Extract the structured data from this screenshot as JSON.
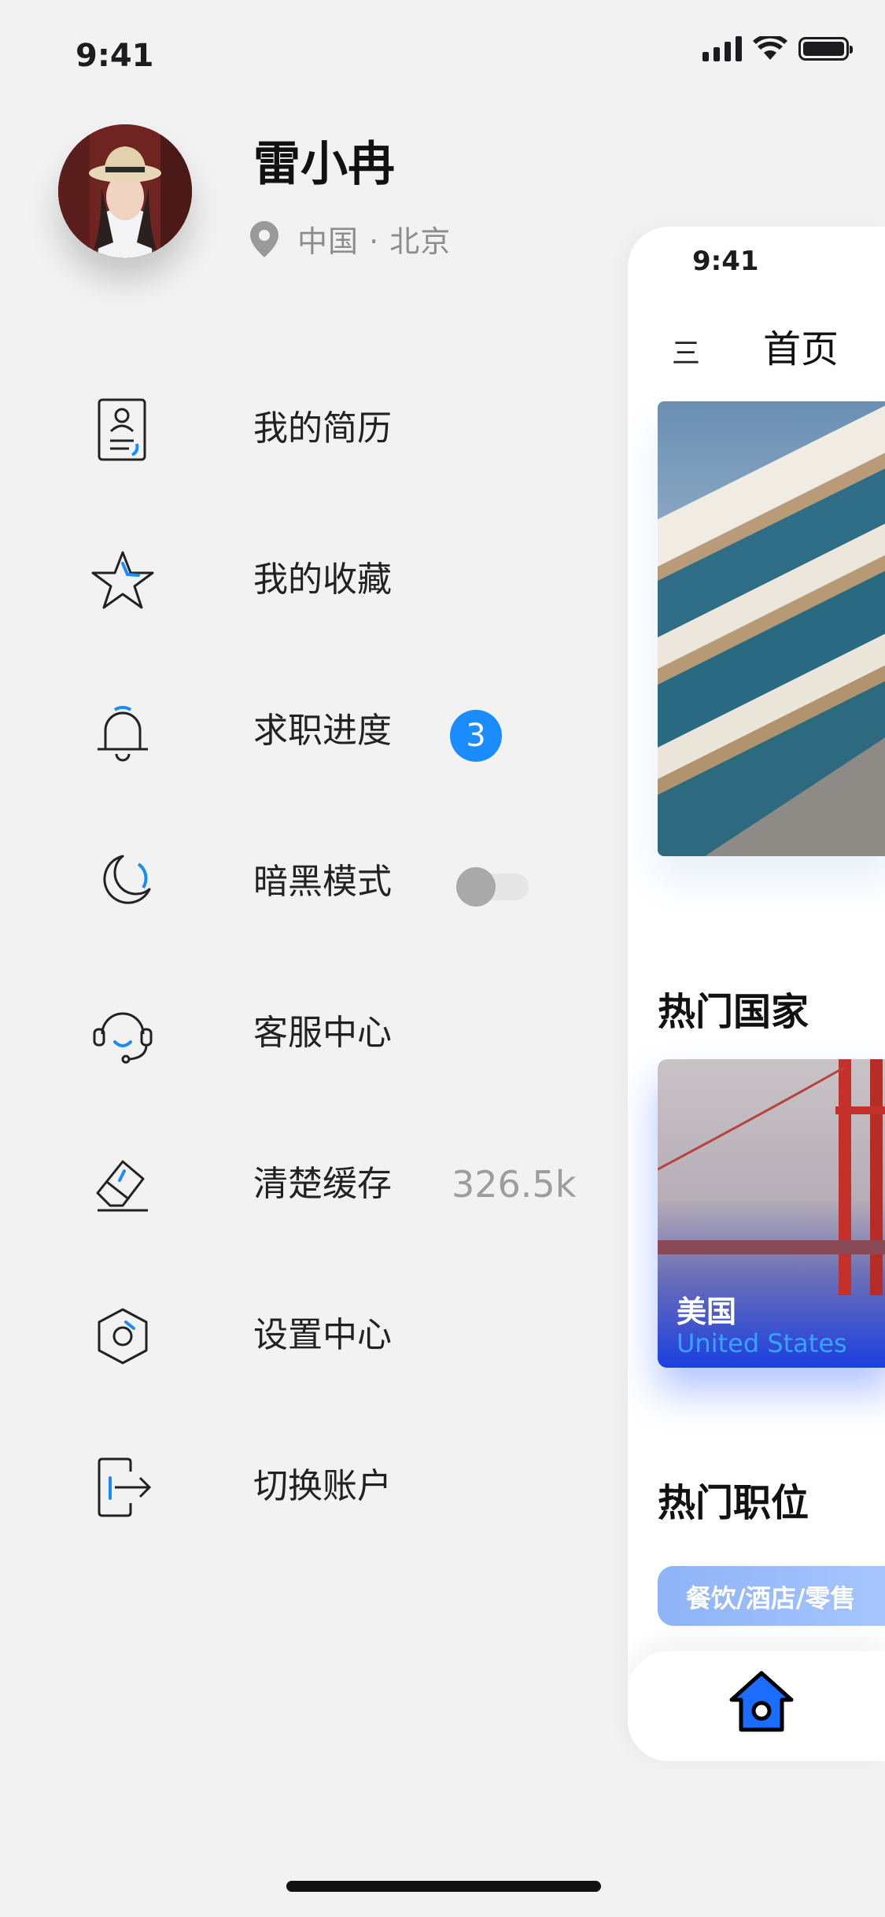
{
  "status_bar": {
    "time": "9:41"
  },
  "profile": {
    "name": "雷小冉",
    "location": "中国 · 北京"
  },
  "menu": [
    {
      "label": "我的简历",
      "icon": "resume-icon"
    },
    {
      "label": "我的收藏",
      "icon": "star-icon"
    },
    {
      "label": "求职进度",
      "icon": "bell-icon",
      "badge": "3"
    },
    {
      "label": "暗黑模式",
      "icon": "moon-icon",
      "toggle_on": false
    },
    {
      "label": "客服中心",
      "icon": "headset-icon"
    },
    {
      "label": "清楚缓存",
      "icon": "eraser-icon",
      "value": "326.5k"
    },
    {
      "label": "设置中心",
      "icon": "settings-hex-icon"
    },
    {
      "label": "切换账户",
      "icon": "switch-account-icon"
    }
  ],
  "preview": {
    "status_time": "9:41",
    "menu_glyph": "三",
    "title": "首页",
    "section_countries": "热门国家",
    "country_card": {
      "name_cn": "美国",
      "name_en": "United States"
    },
    "section_jobs": "热门职位",
    "job_chip": "餐饮/酒店/零售",
    "tab_home_icon": "home-icon"
  },
  "colors": {
    "accent_blue": "#1a8cff",
    "background": "#f2f2f2",
    "text_primary": "#222222",
    "text_secondary": "#8c8c8c"
  }
}
